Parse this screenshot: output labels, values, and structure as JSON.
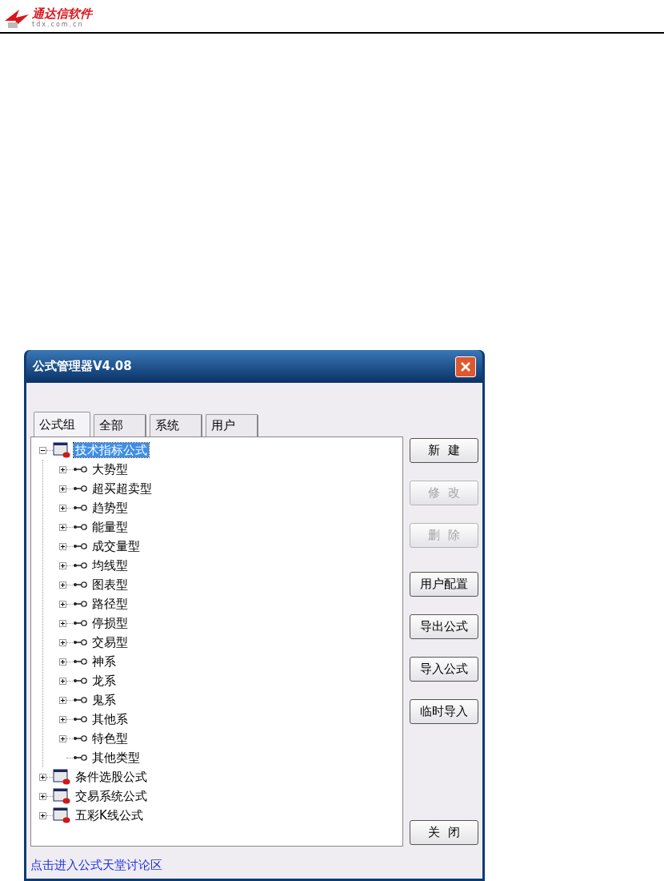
{
  "header": {
    "logo_title": "通达信软件",
    "logo_url": "tdx.com.cn"
  },
  "window": {
    "title": "公式管理器V4.08"
  },
  "tabs": [
    {
      "label": "公式组",
      "selected": true
    },
    {
      "label": "全部",
      "selected": false
    },
    {
      "label": "系统",
      "selected": false
    },
    {
      "label": "用户",
      "selected": false
    }
  ],
  "tree": [
    {
      "label": "技术指标公式",
      "kind": "group",
      "expanded": true,
      "selected": true,
      "children": [
        {
          "label": "大势型",
          "kind": "category",
          "expanded": false,
          "selected": false
        },
        {
          "label": "超买超卖型",
          "kind": "category",
          "expanded": false,
          "selected": false
        },
        {
          "label": "趋势型",
          "kind": "category",
          "expanded": false,
          "selected": false
        },
        {
          "label": "能量型",
          "kind": "category",
          "expanded": false,
          "selected": false
        },
        {
          "label": "成交量型",
          "kind": "category",
          "expanded": false,
          "selected": false
        },
        {
          "label": "均线型",
          "kind": "category",
          "expanded": false,
          "selected": false
        },
        {
          "label": "图表型",
          "kind": "category",
          "expanded": false,
          "selected": false
        },
        {
          "label": "路径型",
          "kind": "category",
          "expanded": false,
          "selected": false
        },
        {
          "label": "停损型",
          "kind": "category",
          "expanded": false,
          "selected": false
        },
        {
          "label": "交易型",
          "kind": "category",
          "expanded": false,
          "selected": false
        },
        {
          "label": "神系",
          "kind": "category",
          "expanded": false,
          "selected": false
        },
        {
          "label": "龙系",
          "kind": "category",
          "expanded": false,
          "selected": false
        },
        {
          "label": "鬼系",
          "kind": "category",
          "expanded": false,
          "selected": false
        },
        {
          "label": "其他系",
          "kind": "category",
          "expanded": false,
          "selected": false
        },
        {
          "label": "特色型",
          "kind": "category",
          "expanded": false,
          "selected": false
        },
        {
          "label": "其他类型",
          "kind": "leaf",
          "selected": false
        }
      ]
    },
    {
      "label": "条件选股公式",
      "kind": "group",
      "expanded": false,
      "selected": false
    },
    {
      "label": "交易系统公式",
      "kind": "group",
      "expanded": false,
      "selected": false
    },
    {
      "label": "五彩K线公式",
      "kind": "group",
      "expanded": false,
      "selected": false
    }
  ],
  "buttons": [
    {
      "label": "新  建",
      "disabled": false
    },
    {
      "label": "修  改",
      "disabled": true
    },
    {
      "label": "删  除",
      "disabled": true
    },
    {
      "label": "用户配置",
      "disabled": false
    },
    {
      "label": "导出公式",
      "disabled": false
    },
    {
      "label": "导入公式",
      "disabled": false
    },
    {
      "label": "临时导入",
      "disabled": false
    },
    {
      "label": "关  闭",
      "disabled": false
    }
  ],
  "footer_link": "点击进入公式天堂讨论区"
}
